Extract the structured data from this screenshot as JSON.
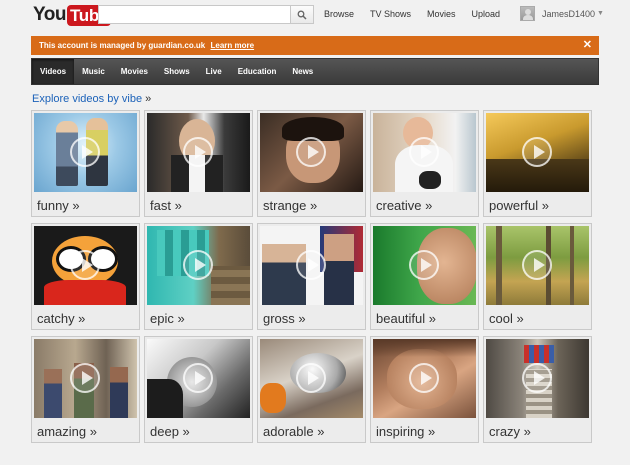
{
  "header": {
    "logo_you": "You",
    "logo_tube": "Tube",
    "search_value": "",
    "links": [
      "Browse",
      "TV Shows",
      "Movies",
      "Upload"
    ],
    "username": "JamesD1400"
  },
  "banner": {
    "text": "This account is managed by guardian.co.uk",
    "link": "Learn more",
    "close": "✕",
    "color": "#d86b18"
  },
  "nav": {
    "tabs": [
      {
        "label": "Videos",
        "active": true
      },
      {
        "label": "Music",
        "active": false
      },
      {
        "label": "Movies",
        "active": false
      },
      {
        "label": "Shows",
        "active": false
      },
      {
        "label": "Live",
        "active": false
      },
      {
        "label": "Education",
        "active": false
      },
      {
        "label": "News",
        "active": false
      }
    ]
  },
  "section": {
    "title": "Explore videos by vibe",
    "arrow": "»"
  },
  "vibes": [
    {
      "label": "funny »"
    },
    {
      "label": "fast »"
    },
    {
      "label": "strange »"
    },
    {
      "label": "creative »"
    },
    {
      "label": "powerful »"
    },
    {
      "label": "catchy »"
    },
    {
      "label": "epic »"
    },
    {
      "label": "gross »"
    },
    {
      "label": "beautiful »"
    },
    {
      "label": "cool »"
    },
    {
      "label": "amazing »"
    },
    {
      "label": "deep »"
    },
    {
      "label": "adorable »"
    },
    {
      "label": "inspiring »"
    },
    {
      "label": "crazy »"
    }
  ]
}
